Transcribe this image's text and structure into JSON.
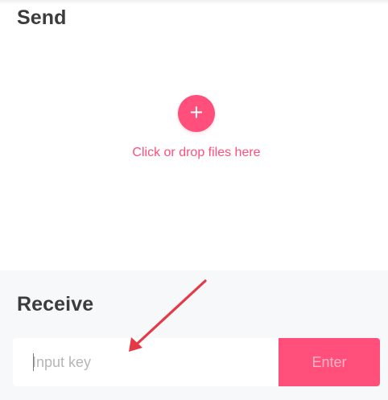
{
  "send": {
    "title": "Send",
    "add_icon_text": "+",
    "drop_text": "Click or drop files here"
  },
  "receive": {
    "title": "Receive",
    "input": {
      "value": "",
      "placeholder": "Input key"
    },
    "button_label": "Enter"
  },
  "colors": {
    "accent": "#ff4f7a",
    "receive_background": "#f7f8fa",
    "annotation_arrow": "#e53945"
  },
  "icons": {
    "add": "plus-circle-icon",
    "annotation": "arrow-pointer-icon"
  }
}
